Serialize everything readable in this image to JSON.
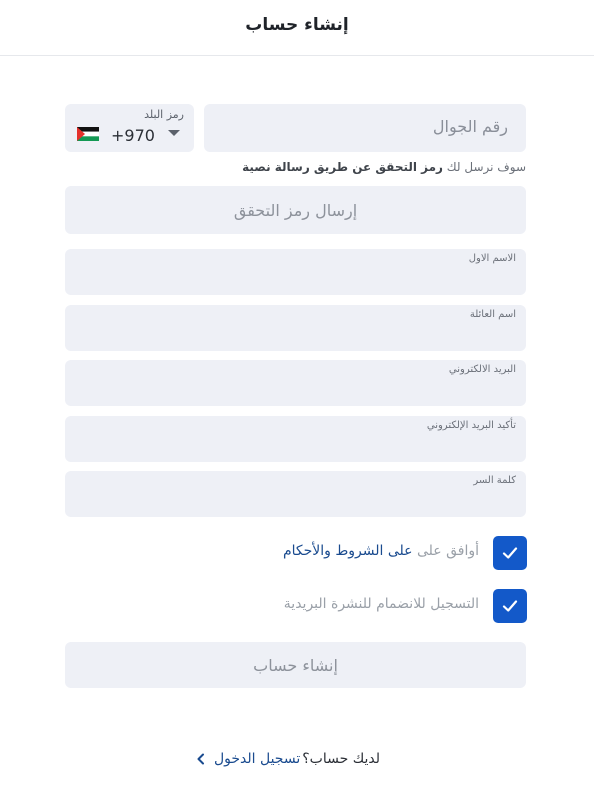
{
  "header": {
    "title": "إنشاء حساب"
  },
  "phone": {
    "placeholder": "رقم الجوال",
    "country_label": "رمز البلد",
    "country_code": "+970",
    "country_flag_icon": "palestine-flag-icon"
  },
  "hint": {
    "prefix": "سوف نرسل لك",
    "bold": "رمز التحقق عن طريق رسالة نصية"
  },
  "send_code": {
    "label": "إرسال رمز التحقق"
  },
  "fields": {
    "first_name": {
      "label": "الاسم الاول",
      "value": ""
    },
    "last_name": {
      "label": "اسم العائلة",
      "value": ""
    },
    "email": {
      "label": "البريد الالكتروني",
      "value": ""
    },
    "email_confirm": {
      "label": "تأكيد البريد الإلكتروني",
      "value": ""
    },
    "password": {
      "label": "كلمة السر",
      "value": ""
    }
  },
  "terms": {
    "prefix": "أوافق على",
    "link": "على الشروط والأحكام",
    "checked": true
  },
  "newsletter": {
    "label": "التسجيل للانضمام للنشرة البريدية",
    "checked": true
  },
  "submit": {
    "label": "إنشاء حساب"
  },
  "footer": {
    "question": "لديك حساب؟",
    "login": "تسجيل الدخول"
  },
  "colors": {
    "accent": "#1359c9",
    "field_bg": "#eef0f6",
    "link": "#1a4b8f"
  }
}
